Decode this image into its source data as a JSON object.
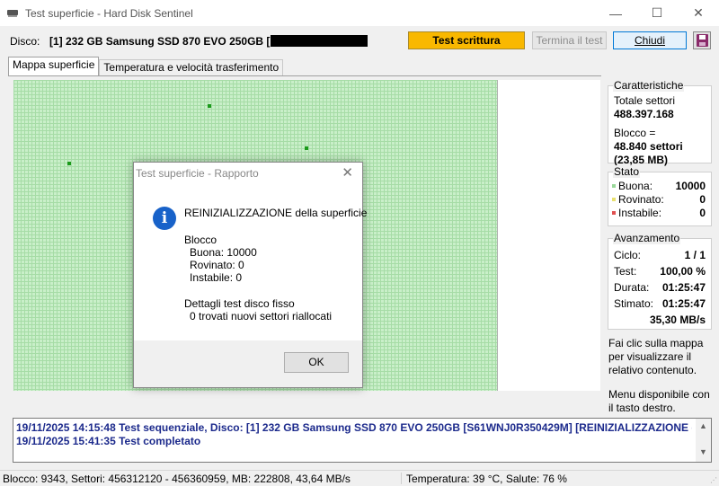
{
  "window": {
    "title": "Test superficie - Hard Disk Sentinel",
    "minimize_glyph": "—",
    "maximize_glyph": "☐",
    "close_glyph": "✕"
  },
  "disk": {
    "label": "Disco:",
    "value": "[1] 232 GB  Samsung SSD 870 EVO 250GB ["
  },
  "toolbar": {
    "test_write_label": "Test scrittura",
    "stop_test_label": "Termina il test",
    "close_label": "Chiudi",
    "save_icon": "floppy-disk-icon"
  },
  "tabs": [
    {
      "label": "Mappa superficie",
      "active": true
    },
    {
      "label": "Temperatura e velocità trasferimento",
      "active": false
    }
  ],
  "characteristics": {
    "title": "Caratteristiche",
    "total_sectors_label": "Totale settori",
    "total_sectors_value": "488.397.168",
    "block_label": "Blocco =",
    "block_value": "48.840 settori",
    "block_size": "(23,85 MB)"
  },
  "state": {
    "title": "Stato",
    "items": [
      {
        "label": "Buona:",
        "value": "10000",
        "color": "#9ad89a"
      },
      {
        "label": "Rovinato:",
        "value": "0",
        "color": "#e8e070"
      },
      {
        "label": "Instabile:",
        "value": "0",
        "color": "#e05050"
      }
    ]
  },
  "progress": {
    "title": "Avanzamento",
    "items": [
      {
        "label": "Ciclo:",
        "value": "1 / 1"
      },
      {
        "label": "Test:",
        "value": "100,00 %"
      },
      {
        "label": "Durata:",
        "value": "01:25:47"
      },
      {
        "label": "Stimato:",
        "value": "01:25:47"
      }
    ],
    "speed": "35,30 MB/s"
  },
  "hints": {
    "click_map": "Fai clic sulla mappa per visualizzare il relativo contenuto.",
    "right_click": "Menu disponibile con il tasto destro."
  },
  "log": [
    "19/11/2025  14:15:48   Test sequenziale, Disco: [1] 232 GB  Samsung SSD 870 EVO 250GB [S61WNJ0R350429M] [REINIZIALIZZAZIONE della superficie]",
    "19/11/2025  15:41:35   Test completato"
  ],
  "status": {
    "left": "Blocco: 9343, Settori: 456312120 - 456360959, MB: 222808, 43,64 MB/s",
    "right": "Temperatura: 39  °C,  Salute: 76 %"
  },
  "dialog": {
    "title": "Test superficie - Rapporto",
    "close_glyph": "✕",
    "info_glyph": "i",
    "heading": "REINIZIALIZZAZIONE della superficie",
    "block_title": "Blocco",
    "good": "  Buona: 10000",
    "damaged": "  Rovinato: 0",
    "unstable": "  Instabile: 0",
    "details_title": "Dettagli test disco fisso",
    "details_line": "  0 trovati nuovi settori riallocati",
    "ok_label": "OK"
  },
  "colors": {
    "accent_button": "#f9b800",
    "map_good": "#c9efc9",
    "log_text": "#1c2a8c",
    "info_icon": "#1862c9"
  }
}
